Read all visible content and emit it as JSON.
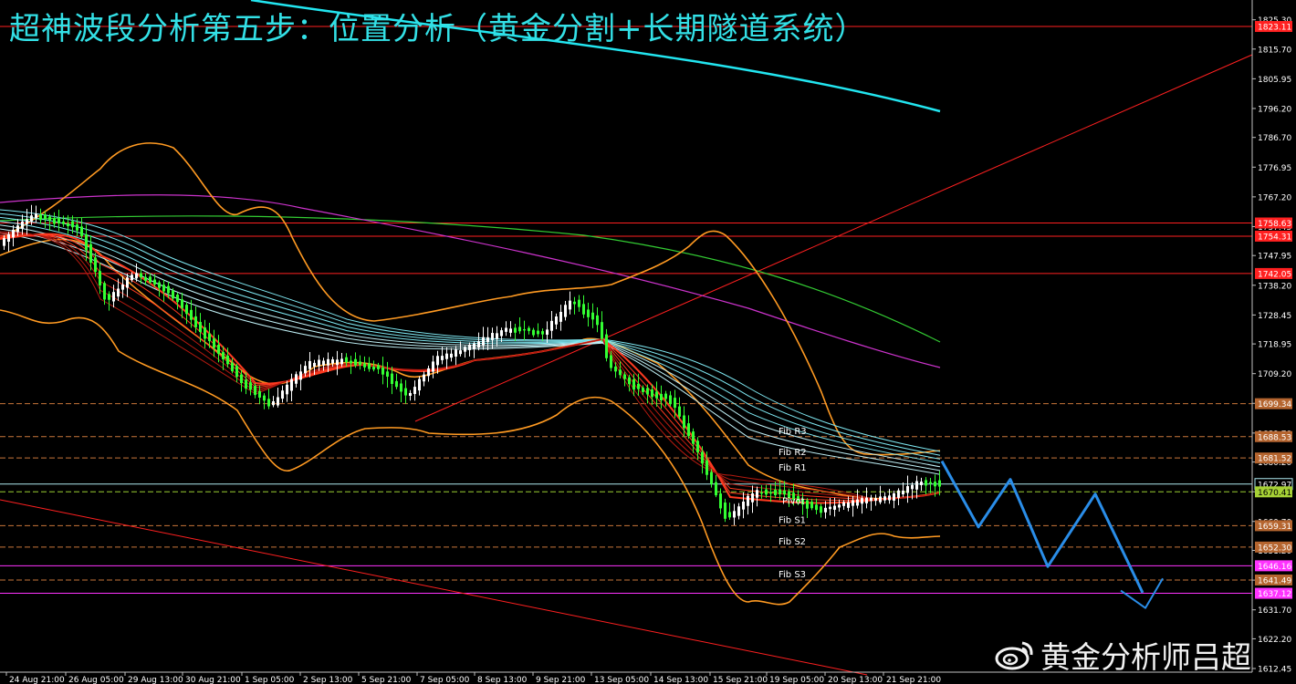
{
  "title": "超神波段分析第五步：位置分析（黄金分割+长期隧道系统）",
  "watermark": {
    "text": "黄金分析师吕超",
    "icon": "weibo-icon"
  },
  "colors": {
    "background": "#000000",
    "title": "#33e0e6",
    "axis_text": "#ffffff",
    "grid_dash": "#8a5a2a",
    "red_line": "#ff2020",
    "pivot_line": "#aeeaf0",
    "magenta_line": "#ff33ff",
    "bollinger": "#ff9a22",
    "ma_green": "#33cc33",
    "ma_magenta": "#cc33cc",
    "ma_cyan_long": "#22e5f0",
    "forecast": "#2a8de8",
    "candle_up": "#ffffff",
    "candle_down": "#33ff33"
  },
  "chart_data": {
    "type": "line",
    "symbol_timeframe": "XAUUSD H4",
    "ylim": [
      1612.45,
      1830.0
    ],
    "y_ticks": [
      1825.3,
      1815.7,
      1805.95,
      1796.2,
      1786.7,
      1776.95,
      1767.2,
      1757.45,
      1747.95,
      1738.2,
      1728.45,
      1718.95,
      1709.2,
      1699.45,
      1689.7,
      1680.2,
      1670.45,
      1660.7,
      1651.2,
      1641.45,
      1631.7,
      1622.2,
      1612.45
    ],
    "x_labels": [
      "24 Aug 21:00",
      "26 Aug 05:00",
      "29 Aug 13:00",
      "30 Aug 21:00",
      "1 Sep 05:00",
      "2 Sep 13:00",
      "5 Sep 21:00",
      "7 Sep 05:00",
      "8 Sep 13:00",
      "9 Sep 21:00",
      "13 Sep 05:00",
      "14 Sep 13:00",
      "15 Sep 21:00",
      "19 Sep 05:00",
      "20 Sep 13:00",
      "21 Sep 21:00"
    ],
    "horizontal_levels": [
      {
        "price": 1823.11,
        "label": "1823.11",
        "style": "solid",
        "color": "#ff2020"
      },
      {
        "price": 1758.63,
        "label": "1758.63",
        "style": "solid",
        "color": "#ff2020"
      },
      {
        "price": 1754.31,
        "label": "1754.31",
        "style": "solid",
        "color": "#ff2020"
      },
      {
        "price": 1742.05,
        "label": "1742.05",
        "style": "solid",
        "color": "#ff2020"
      },
      {
        "price": 1699.34,
        "label": "1699.34",
        "style": "dash",
        "color": "#c8763a"
      },
      {
        "price": 1688.53,
        "label": "1688.53",
        "style": "dash",
        "color": "#c8763a",
        "name": "Fib R3"
      },
      {
        "price": 1681.52,
        "label": "1681.52",
        "style": "dash",
        "color": "#c8763a",
        "name": "Fib R2"
      },
      {
        "price": 1672.97,
        "label": "1672.97",
        "style": "solid",
        "color": "#aeeaf0",
        "name": "Fib R1"
      },
      {
        "price": 1670.41,
        "label": "1670.41",
        "style": "dash",
        "color": "#9acd32",
        "name": "Pivot"
      },
      {
        "price": 1659.31,
        "label": "1659.31",
        "style": "dash",
        "color": "#c8763a",
        "name": "Fib S1"
      },
      {
        "price": 1652.3,
        "label": "1652.30",
        "style": "dash",
        "color": "#c8763a",
        "name": "Fib S2"
      },
      {
        "price": 1646.16,
        "label": "1646.16",
        "style": "solid",
        "color": "#ff33ff"
      },
      {
        "price": 1641.49,
        "label": "1641.49",
        "style": "dash",
        "color": "#c8763a",
        "name": "Fib S3"
      },
      {
        "price": 1637.12,
        "label": "1637.12",
        "style": "solid",
        "color": "#ff33ff"
      }
    ],
    "fib_labels": [
      "Fib R3",
      "Fib R2",
      "Fib R1",
      "Pivot",
      "Fib S1",
      "Fib S2",
      "Fib S3"
    ],
    "forecast_path": [
      1680.5,
      1658.9,
      1674.5,
      1645.9,
      1669.7,
      1637.3,
      1632.3,
      1642.0
    ],
    "forecast_second_leg": [
      1637.3,
      1632.3,
      1642.0
    ],
    "last_price": 1672.97
  }
}
